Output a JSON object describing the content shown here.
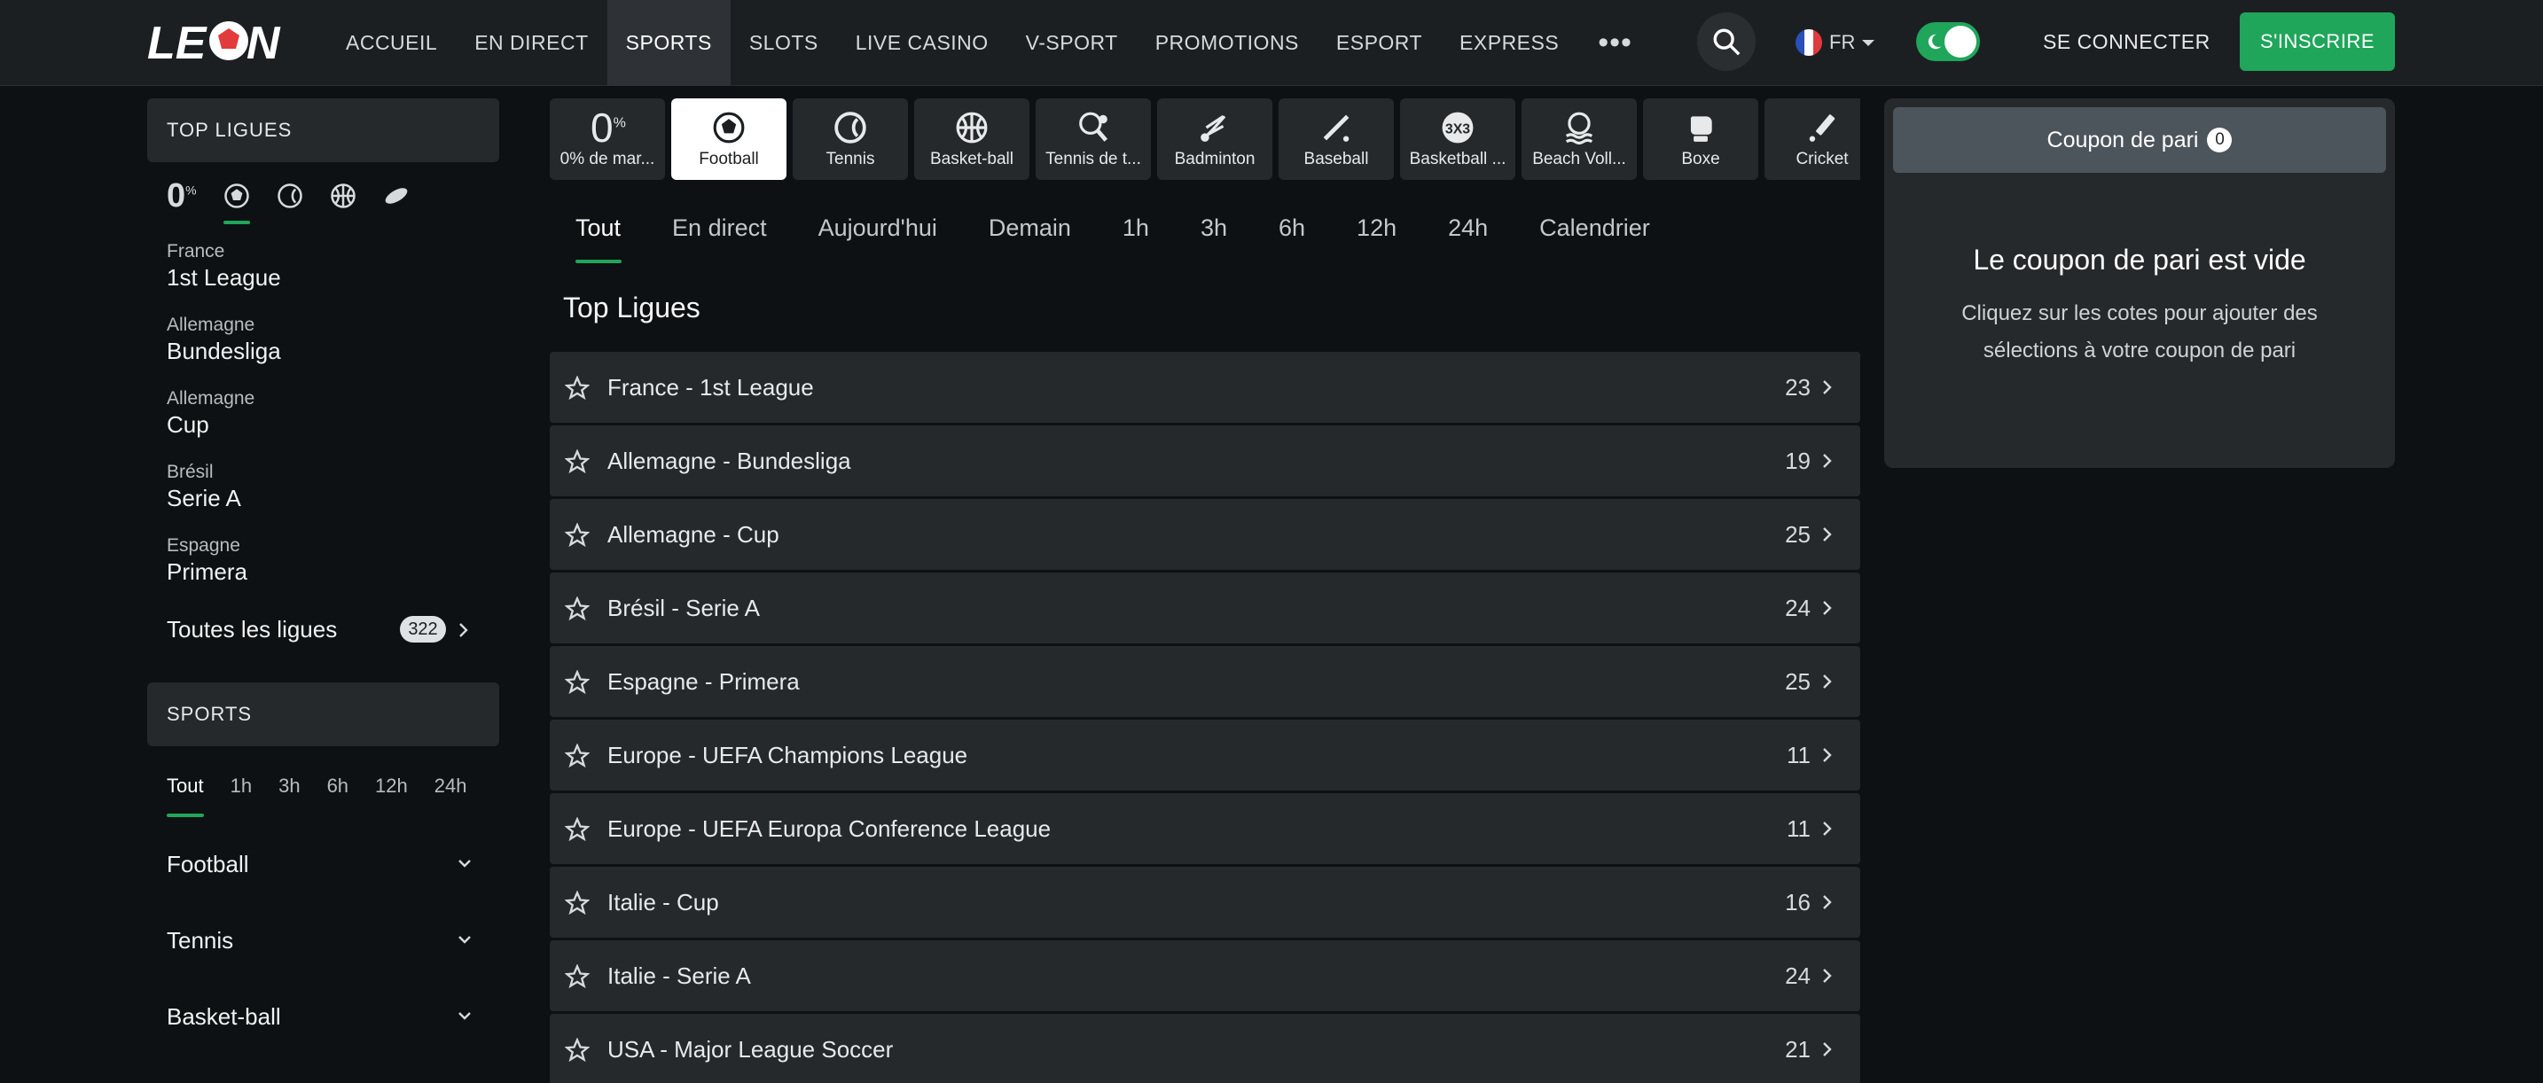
{
  "header": {
    "logo_text": "LEON",
    "nav": [
      {
        "label": "ACCUEIL",
        "active": false
      },
      {
        "label": "EN DIRECT",
        "active": false
      },
      {
        "label": "SPORTS",
        "active": true
      },
      {
        "label": "SLOTS",
        "active": false
      },
      {
        "label": "LIVE CASINO",
        "active": false
      },
      {
        "label": "V-SPORT",
        "active": false
      },
      {
        "label": "PROMOTIONS",
        "active": false
      },
      {
        "label": "ESPORT",
        "active": false
      },
      {
        "label": "EXPRESS",
        "active": false
      }
    ],
    "more_label": "•••",
    "language": "FR",
    "login_label": "SE CONNECTER",
    "signup_label": "S'INSCRIRE",
    "accent_color": "#1fa65a"
  },
  "sidebar": {
    "top_leagues_title": "TOP LIGUES",
    "zero_margin": "0",
    "zero_margin_sup": "%",
    "leagues": [
      {
        "country": "France",
        "name": "1st League"
      },
      {
        "country": "Allemagne",
        "name": "Bundesliga"
      },
      {
        "country": "Allemagne",
        "name": "Cup"
      },
      {
        "country": "Brésil",
        "name": "Serie A"
      },
      {
        "country": "Espagne",
        "name": "Primera"
      }
    ],
    "all_leagues_label": "Toutes les ligues",
    "all_leagues_count": "322",
    "sports_title": "SPORTS",
    "time_filters": [
      "Tout",
      "1h",
      "3h",
      "6h",
      "12h",
      "24h"
    ],
    "sports": [
      "Football",
      "Tennis",
      "Basket-ball"
    ]
  },
  "main": {
    "sport_tabs": [
      {
        "label": "0% de mar...",
        "icon": "zero-margin-icon"
      },
      {
        "label": "Football",
        "icon": "football-icon",
        "active": true
      },
      {
        "label": "Tennis",
        "icon": "tennis-icon"
      },
      {
        "label": "Basket-ball",
        "icon": "basketball-icon"
      },
      {
        "label": "Tennis de t...",
        "icon": "table-tennis-icon"
      },
      {
        "label": "Badminton",
        "icon": "badminton-icon"
      },
      {
        "label": "Baseball",
        "icon": "baseball-icon"
      },
      {
        "label": "Basketball ...",
        "icon": "basketball-3x3-icon"
      },
      {
        "label": "Beach Voll...",
        "icon": "beach-volleyball-icon"
      },
      {
        "label": "Boxe",
        "icon": "boxing-icon"
      },
      {
        "label": "Cricket",
        "icon": "cricket-icon"
      }
    ],
    "sport_zero": "0",
    "sport_zero_sup": "%",
    "filter_tabs": [
      "Tout",
      "En direct",
      "Aujourd'hui",
      "Demain",
      "1h",
      "3h",
      "6h",
      "12h",
      "24h",
      "Calendrier"
    ],
    "section_title": "Top Ligues",
    "leagues": [
      {
        "name": "France - 1st League",
        "count": "23"
      },
      {
        "name": "Allemagne - Bundesliga",
        "count": "19"
      },
      {
        "name": "Allemagne - Cup",
        "count": "25"
      },
      {
        "name": "Brésil - Serie A",
        "count": "24"
      },
      {
        "name": "Espagne - Primera",
        "count": "25"
      },
      {
        "name": "Europe - UEFA Champions League",
        "count": "11"
      },
      {
        "name": "Europe - UEFA Europa Conference League",
        "count": "11"
      },
      {
        "name": "Italie - Cup",
        "count": "16"
      },
      {
        "name": "Italie - Serie A",
        "count": "24"
      },
      {
        "name": "USA - Major League Soccer",
        "count": "21"
      }
    ]
  },
  "coupon": {
    "title": "Coupon de pari",
    "count": "0",
    "empty_title": "Le coupon de pari est vide",
    "empty_text": "Cliquez sur les cotes pour ajouter des sélections à votre coupon de pari"
  }
}
